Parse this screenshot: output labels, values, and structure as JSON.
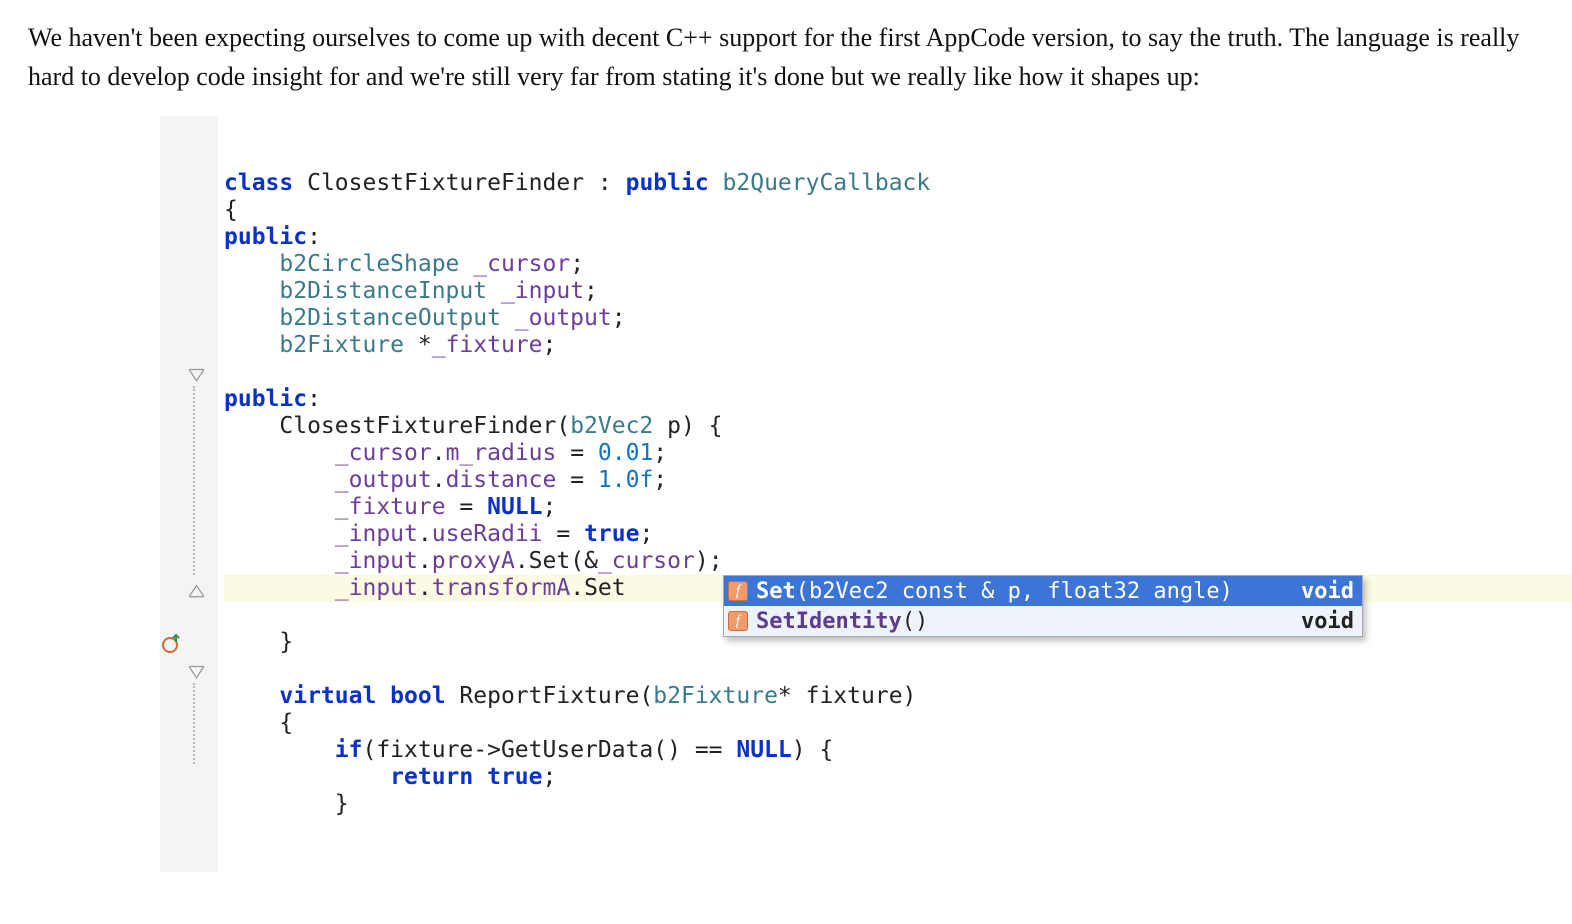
{
  "article": {
    "paragraph": "We haven't been expecting ourselves to come up with decent C++ support for the first AppCode version, to say the truth. The language is really hard to develop code insight for and we're still very far from stating it's done but we really like how it shapes up:"
  },
  "code": {
    "lines": [
      {
        "segments": [
          {
            "t": "class ",
            "c": "kw"
          },
          {
            "t": "ClosestFixtureFinder ",
            "c": "plain"
          },
          {
            "t": ": ",
            "c": "plain"
          },
          {
            "t": "public ",
            "c": "kw"
          },
          {
            "t": "b2QueryCallback",
            "c": "type"
          }
        ]
      },
      {
        "segments": [
          {
            "t": "{",
            "c": "plain"
          }
        ]
      },
      {
        "segments": [
          {
            "t": "public",
            "c": "kw"
          },
          {
            "t": ":",
            "c": "plain"
          }
        ]
      },
      {
        "segments": [
          {
            "t": "    ",
            "c": "plain"
          },
          {
            "t": "b2CircleShape ",
            "c": "type"
          },
          {
            "t": "_cursor",
            "c": "ident"
          },
          {
            "t": ";",
            "c": "plain"
          }
        ]
      },
      {
        "segments": [
          {
            "t": "    ",
            "c": "plain"
          },
          {
            "t": "b2DistanceInput ",
            "c": "type"
          },
          {
            "t": "_input",
            "c": "ident"
          },
          {
            "t": ";",
            "c": "plain"
          }
        ]
      },
      {
        "segments": [
          {
            "t": "    ",
            "c": "plain"
          },
          {
            "t": "b2DistanceOutput ",
            "c": "type"
          },
          {
            "t": "_output",
            "c": "ident"
          },
          {
            "t": ";",
            "c": "plain"
          }
        ]
      },
      {
        "segments": [
          {
            "t": "    ",
            "c": "plain"
          },
          {
            "t": "b2Fixture ",
            "c": "type"
          },
          {
            "t": "*",
            "c": "plain"
          },
          {
            "t": "_fixture",
            "c": "ident"
          },
          {
            "t": ";",
            "c": "plain"
          }
        ]
      },
      {
        "segments": [
          {
            "t": "",
            "c": "plain"
          }
        ]
      },
      {
        "segments": [
          {
            "t": "public",
            "c": "kw"
          },
          {
            "t": ":",
            "c": "plain"
          }
        ]
      },
      {
        "segments": [
          {
            "t": "    ClosestFixtureFinder(",
            "c": "plain"
          },
          {
            "t": "b2Vec2 ",
            "c": "type"
          },
          {
            "t": "p",
            "c": "plain"
          },
          {
            "t": ") {",
            "c": "plain"
          }
        ]
      },
      {
        "segments": [
          {
            "t": "        ",
            "c": "plain"
          },
          {
            "t": "_cursor",
            "c": "ident"
          },
          {
            "t": ".",
            "c": "plain"
          },
          {
            "t": "m_radius",
            "c": "ident"
          },
          {
            "t": " = ",
            "c": "plain"
          },
          {
            "t": "0.01",
            "c": "num"
          },
          {
            "t": ";",
            "c": "plain"
          }
        ]
      },
      {
        "segments": [
          {
            "t": "        ",
            "c": "plain"
          },
          {
            "t": "_output",
            "c": "ident"
          },
          {
            "t": ".",
            "c": "plain"
          },
          {
            "t": "distance",
            "c": "ident"
          },
          {
            "t": " = ",
            "c": "plain"
          },
          {
            "t": "1.0f",
            "c": "num"
          },
          {
            "t": ";",
            "c": "plain"
          }
        ]
      },
      {
        "segments": [
          {
            "t": "        ",
            "c": "plain"
          },
          {
            "t": "_fixture",
            "c": "ident"
          },
          {
            "t": " = ",
            "c": "plain"
          },
          {
            "t": "NULL",
            "c": "kw"
          },
          {
            "t": ";",
            "c": "plain"
          }
        ]
      },
      {
        "segments": [
          {
            "t": "        ",
            "c": "plain"
          },
          {
            "t": "_input",
            "c": "ident"
          },
          {
            "t": ".",
            "c": "plain"
          },
          {
            "t": "useRadii",
            "c": "ident"
          },
          {
            "t": " = ",
            "c": "plain"
          },
          {
            "t": "true",
            "c": "kw"
          },
          {
            "t": ";",
            "c": "plain"
          }
        ]
      },
      {
        "segments": [
          {
            "t": "        ",
            "c": "plain"
          },
          {
            "t": "_input",
            "c": "ident"
          },
          {
            "t": ".",
            "c": "plain"
          },
          {
            "t": "proxyA",
            "c": "ident"
          },
          {
            "t": ".Set(&",
            "c": "plain"
          },
          {
            "t": "_cursor",
            "c": "ident"
          },
          {
            "t": ");",
            "c": "plain"
          }
        ]
      },
      {
        "hilite": true,
        "segments": [
          {
            "t": "        ",
            "c": "plain"
          },
          {
            "t": "_input",
            "c": "ident"
          },
          {
            "t": ".",
            "c": "plain"
          },
          {
            "t": "transformA",
            "c": "ident"
          },
          {
            "t": ".Set",
            "c": "plain"
          }
        ]
      },
      {
        "segments": [
          {
            "t": "",
            "c": "plain"
          }
        ]
      },
      {
        "segments": [
          {
            "t": "    }",
            "c": "plain"
          }
        ]
      },
      {
        "segments": [
          {
            "t": "",
            "c": "plain"
          }
        ]
      },
      {
        "segments": [
          {
            "t": "    ",
            "c": "plain"
          },
          {
            "t": "virtual ",
            "c": "kw"
          },
          {
            "t": "bool ",
            "c": "kw"
          },
          {
            "t": "ReportFixture(",
            "c": "plain"
          },
          {
            "t": "b2Fixture",
            "c": "type"
          },
          {
            "t": "* fixture)",
            "c": "plain"
          }
        ]
      },
      {
        "segments": [
          {
            "t": "    {",
            "c": "plain"
          }
        ]
      },
      {
        "segments": [
          {
            "t": "        ",
            "c": "plain"
          },
          {
            "t": "if",
            "c": "kw"
          },
          {
            "t": "(fixture->GetUserData() == ",
            "c": "plain"
          },
          {
            "t": "NULL",
            "c": "kw"
          },
          {
            "t": ") {",
            "c": "plain"
          }
        ]
      },
      {
        "segments": [
          {
            "t": "            ",
            "c": "plain"
          },
          {
            "t": "return ",
            "c": "kw"
          },
          {
            "t": "true",
            "c": "kw"
          },
          {
            "t": ";",
            "c": "plain"
          }
        ]
      },
      {
        "segments": [
          {
            "t": "        }",
            "c": "plain"
          }
        ]
      }
    ]
  },
  "popup": {
    "items": [
      {
        "icon": "f",
        "name": "Set",
        "params": "(b2Vec2 const & p, float32 angle)",
        "ret": "void",
        "selected": true
      },
      {
        "icon": "f",
        "name": "SetIdentity",
        "params": "()",
        "ret": "void",
        "selected": false
      }
    ]
  },
  "gutter": {
    "fold_icons": [
      {
        "line": 9,
        "kind": "open"
      },
      {
        "line": 17,
        "kind": "close"
      },
      {
        "line": 20,
        "kind": "open"
      }
    ],
    "override_icon_line": 19
  }
}
